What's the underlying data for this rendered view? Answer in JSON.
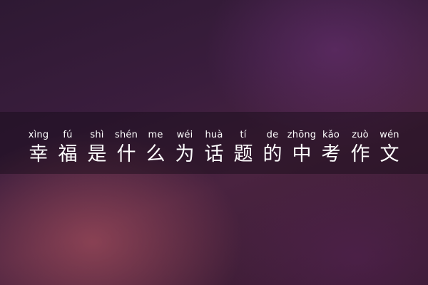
{
  "title": {
    "syllables": [
      {
        "pinyin": "xìng",
        "hanzi": "幸"
      },
      {
        "pinyin": "fú",
        "hanzi": "福"
      },
      {
        "pinyin": "shì",
        "hanzi": "是"
      },
      {
        "pinyin": "shén",
        "hanzi": "什"
      },
      {
        "pinyin": "me",
        "hanzi": "么"
      },
      {
        "pinyin": "wéi",
        "hanzi": "为"
      },
      {
        "pinyin": "huà",
        "hanzi": "话"
      },
      {
        "pinyin": "tí",
        "hanzi": "题"
      },
      {
        "pinyin": "de",
        "hanzi": "的"
      },
      {
        "pinyin": "zhōng",
        "hanzi": "中"
      },
      {
        "pinyin": "kǎo",
        "hanzi": "考"
      },
      {
        "pinyin": "zuò",
        "hanzi": "作"
      },
      {
        "pinyin": "wén",
        "hanzi": "文"
      }
    ]
  },
  "colors": {
    "text": "#ffffff",
    "band": "rgba(20,10,22,0.45)",
    "background_base": "#3a1d3d",
    "glow_left": "#be5a64",
    "glow_right": "#6e3278"
  }
}
